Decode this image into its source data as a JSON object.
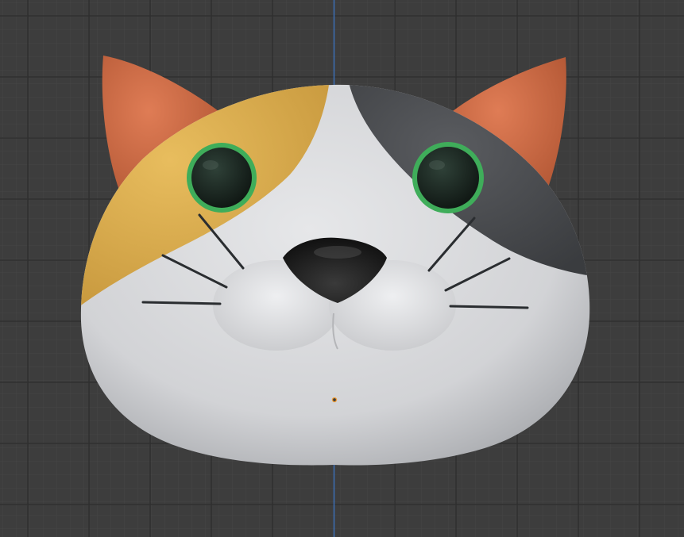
{
  "viewport": {
    "background_color": "#3d3d3d",
    "grid_minor_color": "#454545",
    "grid_major_color": "#2c2c2c",
    "axis_color": "#3d6fb5",
    "origin_color": "#f19d34"
  },
  "model": {
    "object": "calico-cat-head",
    "colors": {
      "fur_white": "#d6d7d9",
      "patch_orange": "#e1b352",
      "patch_dark": "#4e5053",
      "ear": "#d26e48",
      "eye": "#1c2a24",
      "eye_rim": "#3fad5a",
      "nose": "#1e1e1e",
      "whisker": "#2a2d30"
    }
  }
}
